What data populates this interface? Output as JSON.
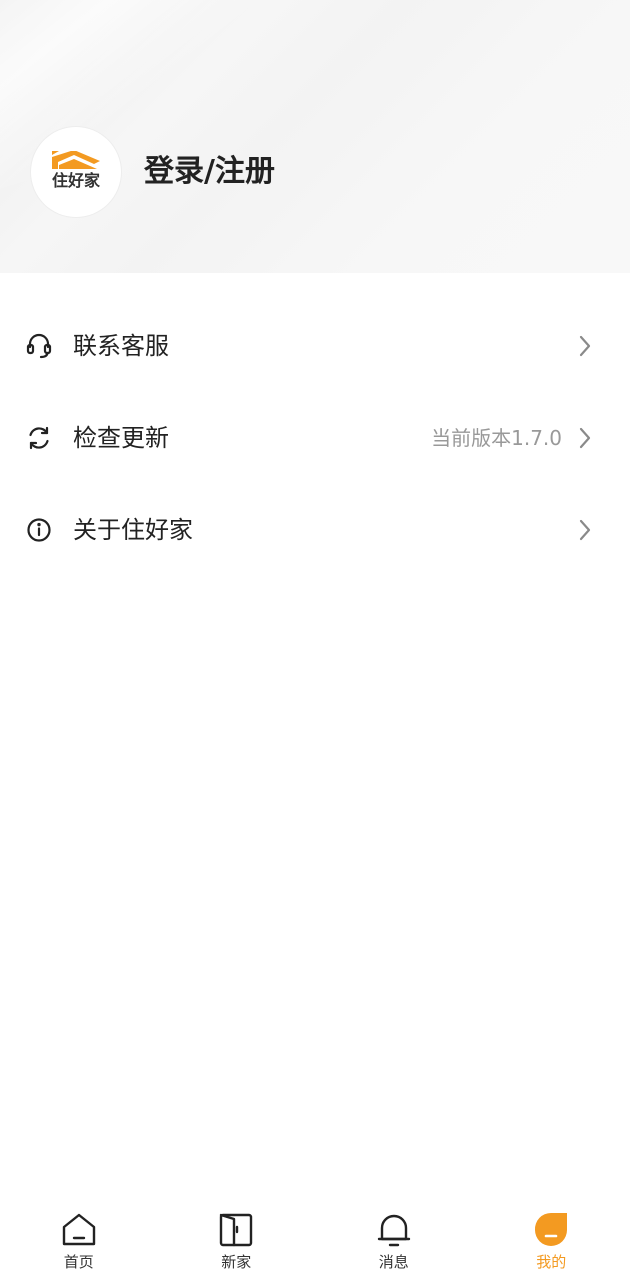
{
  "profile": {
    "logo_text": "住好家",
    "login_label": "登录/注册"
  },
  "menu": {
    "items": [
      {
        "label": "联系客服",
        "icon": "headset-icon",
        "extra": ""
      },
      {
        "label": "检查更新",
        "icon": "refresh-icon",
        "extra": "当前版本1.7.0"
      },
      {
        "label": "关于住好家",
        "icon": "info-icon",
        "extra": ""
      }
    ]
  },
  "tabbar": {
    "items": [
      {
        "label": "首页",
        "icon": "home-icon"
      },
      {
        "label": "新家",
        "icon": "door-icon"
      },
      {
        "label": "消息",
        "icon": "bell-icon"
      },
      {
        "label": "我的",
        "icon": "profile-icon"
      }
    ],
    "active_index": 3
  },
  "colors": {
    "accent": "#f39a21",
    "text_primary": "#222222",
    "text_secondary": "#999999"
  }
}
